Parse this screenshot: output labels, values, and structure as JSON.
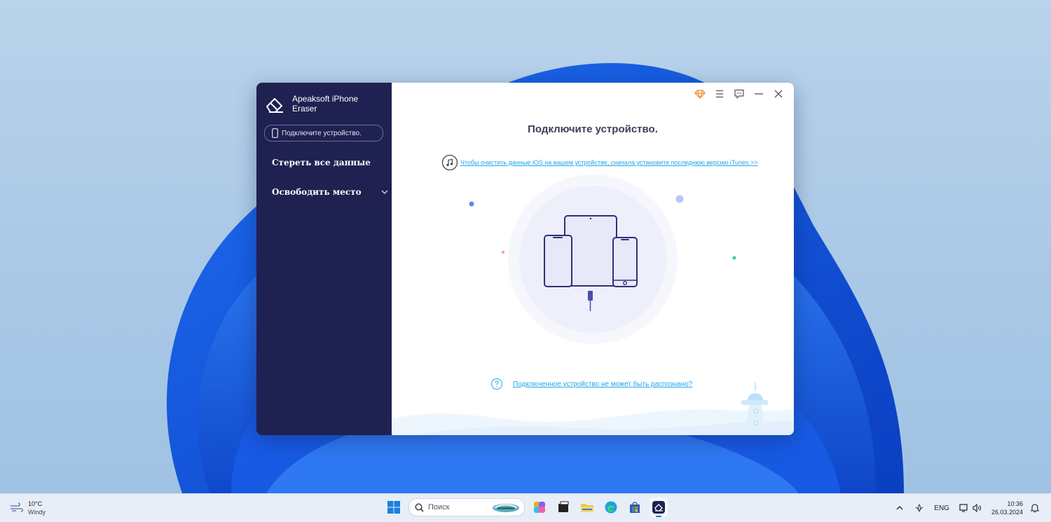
{
  "app": {
    "name": "Apeaksoft iPhone Eraser",
    "device_status": "Подключите устройство.",
    "nav": [
      {
        "label": "Стереть все данные"
      },
      {
        "label": "Освободить место"
      }
    ],
    "main_title": "Подключите устройство.",
    "itunes_link": "Чтобы очистить данные iOS на вашем устройстве, сначала установите последнюю версию iTunes.>>",
    "help_link": "Подключенное устройство не может быть распознано?",
    "accent_color": "#1da6e8",
    "sidebar_color": "#1f2151",
    "icons": {
      "premium": "diamond-icon",
      "menu": "menu-icon",
      "feedback": "chat-icon",
      "minimize": "minimize-icon",
      "close": "close-icon"
    }
  },
  "taskbar": {
    "weather_temp": "10°C",
    "weather_desc": "Windy",
    "search_placeholder": "Поиск",
    "lang": "ENG",
    "time": "10:36",
    "date": "26.03.2024"
  }
}
